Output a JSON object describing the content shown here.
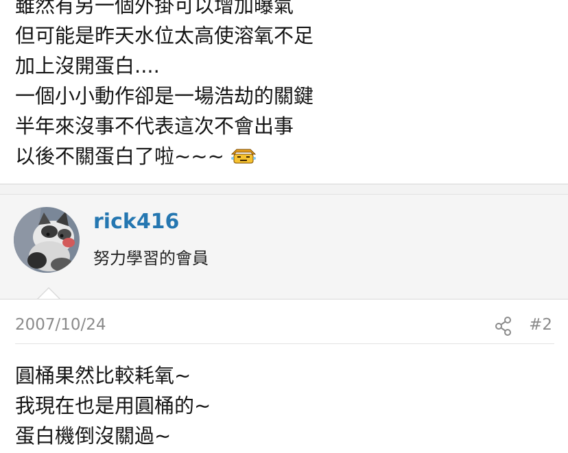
{
  "post1": {
    "lines": [
      "雖然有另一個外掛可以增加曝氣",
      "但可能是昨天水位太高使溶氧不足",
      "加上沒開蛋白....",
      "一個小小動作卻是一場浩劫的關鍵",
      "半年來沒事不代表這次不會出事",
      "以後不關蛋白了啦~~~"
    ],
    "emoji_icon": "sweat-smiley-icon"
  },
  "user": {
    "name": "rick416",
    "title": "努力學習的會員",
    "avatar_icon": "kitten-avatar"
  },
  "post2": {
    "date": "2007/10/24",
    "number": "#2",
    "share_icon": "share-icon",
    "lines": [
      "圓桶果然比較耗氧~",
      "我現在也是用圓桶的~",
      "蛋白機倒沒關過~"
    ]
  },
  "colors": {
    "username": "#2577b1",
    "meta_text": "#8a8a8a",
    "userbar_bg": "#f5f5f5"
  }
}
